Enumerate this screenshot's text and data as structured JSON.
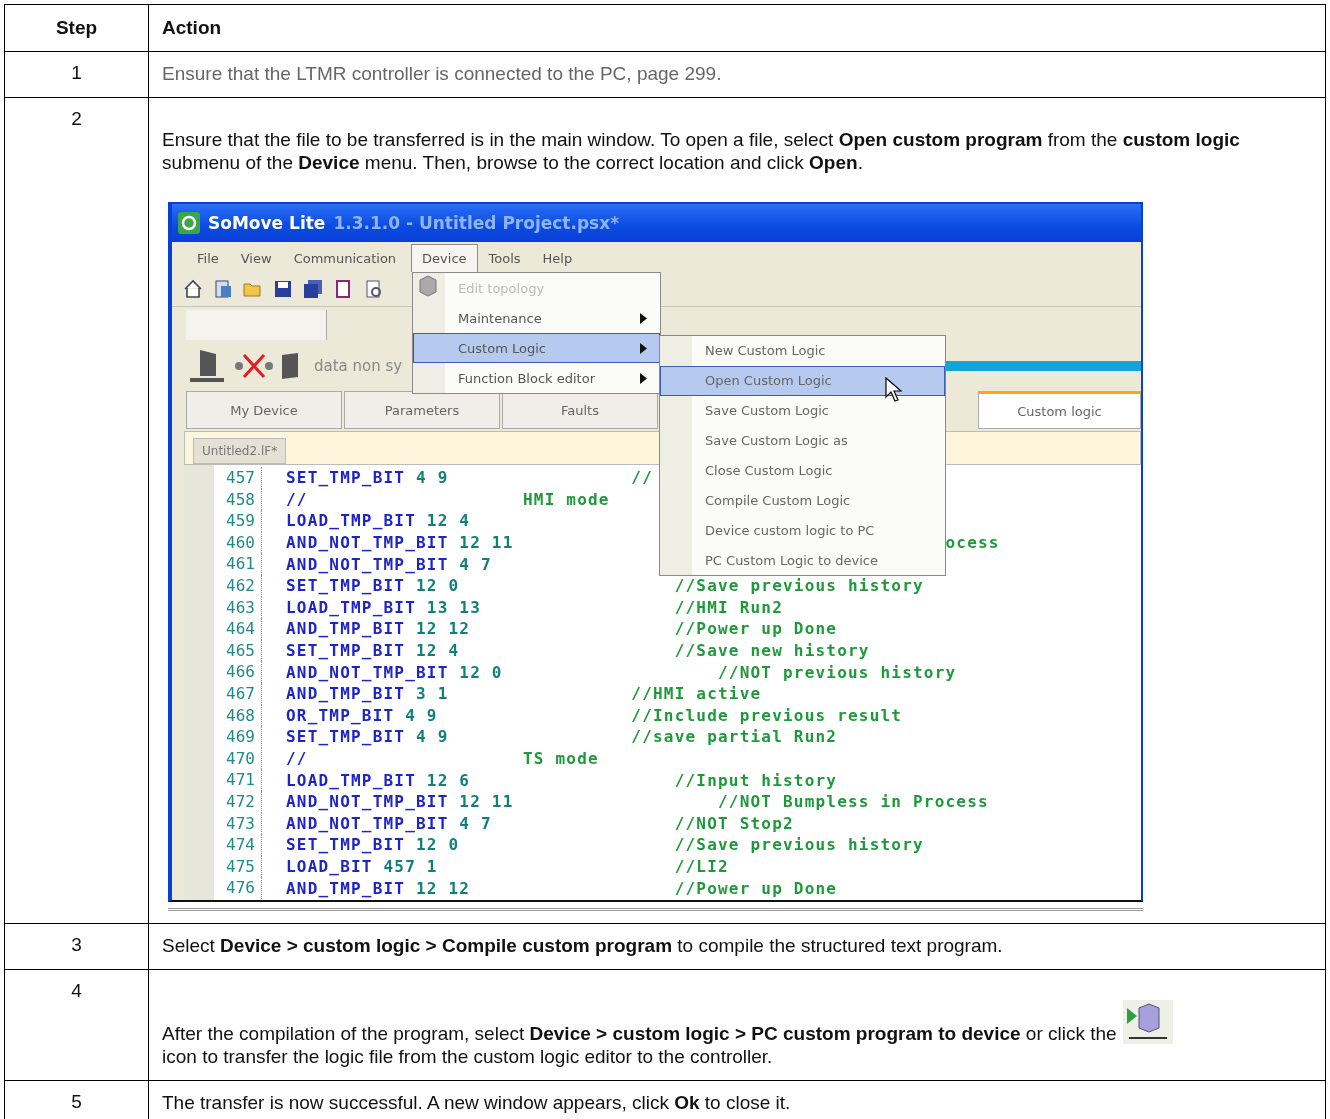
{
  "table": {
    "columns": [
      "Step",
      "Action"
    ],
    "rows": [
      {
        "step": "1",
        "kind": "link",
        "text": "Ensure that the LTMR controller is connected to the PC, page 299."
      },
      {
        "step": "2",
        "kind": "figure",
        "text": "Ensure that the file to be transferred is in the main window. To open a file, select **Open custom program** from the **custom logic** submenu of the **Device** menu. Then, browse to the correct location and click **Open**.",
        "screenshot": {
          "title": "SoMove Lite",
          "title_rest": "1.3.1.0 - Untitled Project.psx*",
          "menu": [
            {
              "label": "File",
              "open": false
            },
            {
              "label": "View",
              "open": false
            },
            {
              "label": "Communication",
              "open": false
            },
            {
              "label": "Device",
              "open": true
            },
            {
              "label": "Tools",
              "open": false
            },
            {
              "label": "Help",
              "open": false
            }
          ],
          "dropdown": [
            {
              "label": "Edit topology",
              "disabled": true,
              "submenu": false,
              "selected": false
            },
            {
              "label": "Maintenance",
              "disabled": false,
              "submenu": true,
              "selected": false
            },
            {
              "label": "Custom Logic",
              "disabled": false,
              "submenu": true,
              "selected": true
            },
            {
              "label": "Function Block editor",
              "disabled": false,
              "submenu": true,
              "selected": false
            }
          ],
          "submenu": [
            {
              "label": "New Custom Logic",
              "selected": false
            },
            {
              "label": "Open Custom Logic",
              "selected": true
            },
            {
              "label": "Save Custom Logic",
              "selected": false
            },
            {
              "label": "Save Custom Logic as",
              "selected": false
            },
            {
              "label": "Close Custom Logic",
              "selected": false
            },
            {
              "label": "Compile Custom Logic",
              "selected": false
            },
            {
              "label": "Device custom logic to PC",
              "selected": false
            },
            {
              "label": "PC Custom Logic to device",
              "selected": false
            }
          ],
          "status_text": "data non sy",
          "progress": {
            "level": 1
          },
          "tabs": [
            {
              "label": "My Device",
              "selected": false
            },
            {
              "label": "Parameters",
              "selected": false
            },
            {
              "label": "Faults",
              "selected": false
            },
            {
              "label": "Custom logic",
              "selected": true
            }
          ],
          "document_tab": "Untitled2.lF*",
          "lines": [
            {
              "number": "457",
              "code": "SET_TMP_BIT 4 9",
              "comment": "          //"
            },
            {
              "number": "458",
              "code": "//",
              "comment": "HMI mode"
            },
            {
              "number": "459",
              "code": "LOAD_TMP_BIT 12 4"
            },
            {
              "number": "460",
              "code": "AND_NOT_TMP_BIT 12 11",
              "comment": "                                       ocess"
            },
            {
              "number": "461",
              "code": "AND_NOT_TMP_BIT 4 7"
            },
            {
              "number": "462",
              "code": "SET_TMP_BIT 12 0",
              "comment": "              //Save previous history"
            },
            {
              "number": "463",
              "code": "LOAD_TMP_BIT 13 13",
              "comment": "              //HMI Run2"
            },
            {
              "number": "464",
              "code": "AND_TMP_BIT 12 12",
              "comment": "              //Power up Done"
            },
            {
              "number": "465",
              "code": "SET_TMP_BIT 12 4",
              "comment": "              //Save new history"
            },
            {
              "number": "466",
              "code": "AND_NOT_TMP_BIT 12 0",
              "comment": "                  //NOT previous history"
            },
            {
              "number": "467",
              "code": "AND_TMP_BIT 3 1",
              "comment": "          //HMI active"
            },
            {
              "number": "468",
              "code": "OR_TMP_BIT 4 9",
              "comment": "          //Include previous result"
            },
            {
              "number": "469",
              "code": "SET_TMP_BIT 4 9",
              "comment": "          //save partial Run2"
            },
            {
              "number": "470",
              "code": "//",
              "comment": "TS mode"
            },
            {
              "number": "471",
              "code": "LOAD_TMP_BIT 12 6",
              "comment": "              //Input history"
            },
            {
              "number": "472",
              "code": "AND_NOT_TMP_BIT 12 11",
              "comment": "                  //NOT Bumpless in Process"
            },
            {
              "number": "473",
              "code": "AND_NOT_TMP_BIT 4 7",
              "comment": "              //NOT Stop2"
            },
            {
              "number": "474",
              "code": "SET_TMP_BIT 12 0",
              "comment": "              //Save previous history"
            },
            {
              "number": "475",
              "code": "LOAD_BIT 457 1",
              "comment": "              //LI2"
            },
            {
              "number": "476",
              "code": "AND_TMP_BIT 12 12",
              "comment": "              //Power up Done"
            }
          ]
        }
      },
      {
        "step": "3",
        "kind": "plain",
        "text": "Select **Device** **>** **custom logic** **>** **Compile custom program** to compile the structured text program."
      },
      {
        "step": "4",
        "kind": "with_icon",
        "text": "After the compilation of the program, select **Device** **>** **custom logic** **>** **PC custom program to device** or click the",
        "text_after": "icon to transfer the logic file from the custom logic editor to the controller."
      },
      {
        "step": "5",
        "kind": "plain",
        "text": "The transfer is now successful. A new window appears, click **Ok** to close it."
      }
    ]
  }
}
